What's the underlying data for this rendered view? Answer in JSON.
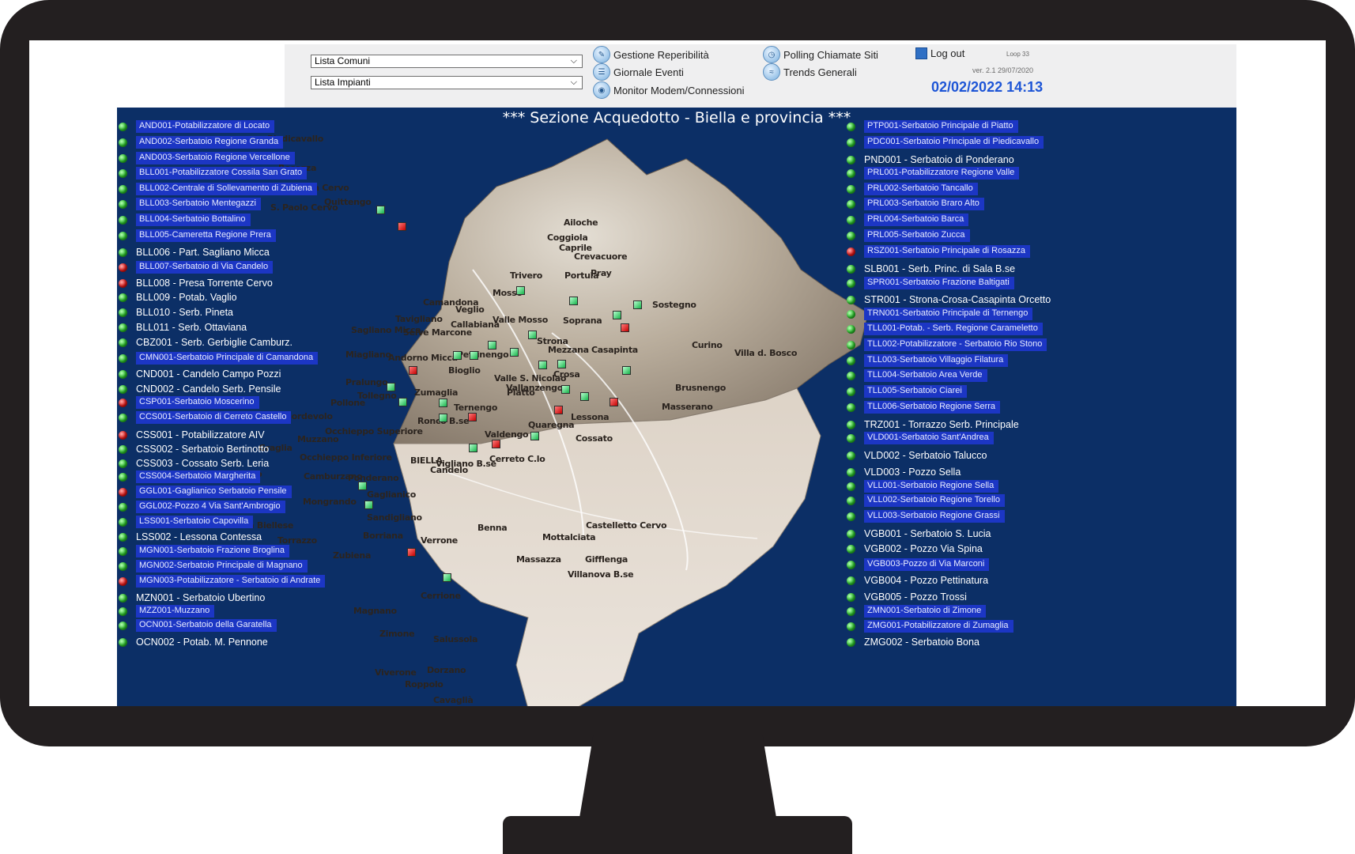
{
  "toolbar": {
    "lista_comuni": "Lista Comuni",
    "lista_impianti": "Lista Impianti",
    "links": {
      "gestione": "Gestione Reperibilità",
      "giornale": "Giornale Eventi",
      "monitor": "Monitor Modem/Connessioni",
      "polling": "Polling Chiamate Siti",
      "trends": "Trends Generali",
      "logout": "Log out"
    },
    "loop": "Loop   33",
    "version": "ver. 2.1 29/07/2020",
    "datetime": "02/02/2022 14:13"
  },
  "section_title": "*** Sezione Acquedotto - Biella e provincia ***",
  "left_sites": [
    {
      "label": "AND001-Potabilizzatore di Locato",
      "status": "green",
      "style": "box"
    },
    {
      "label": "AND002-Serbatoio Regione Granda",
      "status": "green",
      "style": "box"
    },
    {
      "label": "AND003-Serbatoio Regione Vercellone",
      "status": "green",
      "style": "box"
    },
    {
      "label": "BLL001-Potabilizzatore Cossila San Grato",
      "status": "green",
      "style": "box"
    },
    {
      "label": "BLL002-Centrale di Sollevamento di Zubiena",
      "status": "green",
      "style": "box"
    },
    {
      "label": "BLL003-Serbatoio Mentegazzi",
      "status": "green",
      "style": "box"
    },
    {
      "label": "BLL004-Serbatoio Bottalino",
      "status": "green",
      "style": "box"
    },
    {
      "label": "BLL005-Cameretta Regione Prera",
      "status": "green",
      "style": "box"
    },
    {
      "label": "BLL006 - Part. Sagliano Micca",
      "status": "green",
      "style": "big"
    },
    {
      "label": "BLL007-Serbatoio di Via Candelo",
      "status": "red",
      "style": "box"
    },
    {
      "label": "BLL008 - Presa Torrente Cervo",
      "status": "red",
      "style": "big"
    },
    {
      "label": "BLL009 - Potab. Vaglio",
      "status": "green",
      "style": "big"
    },
    {
      "label": "BLL010 - Serb. Pineta",
      "status": "green",
      "style": "big"
    },
    {
      "label": "BLL011 - Serb. Ottaviana",
      "status": "green",
      "style": "big"
    },
    {
      "label": "CBZ001 - Serb. Gerbiglie Camburz.",
      "status": "green",
      "style": "big"
    },
    {
      "label": "CMN001-Serbatoio Principale di Camandona",
      "status": "green",
      "style": "box"
    },
    {
      "label": "CND001 - Candelo Campo Pozzi",
      "status": "green",
      "style": "big"
    },
    {
      "label": "CND002 - Candelo Serb. Pensile",
      "status": "green",
      "style": "big"
    },
    {
      "label": "CSP001-Serbatoio Moscerino",
      "status": "red",
      "style": "box"
    },
    {
      "label": "CCS001-Serbatoio di Cerreto Castello",
      "status": "green",
      "style": "box"
    },
    {
      "label": "CSS001 - Potabilizzatore AIV",
      "status": "red",
      "style": "big"
    },
    {
      "label": "CSS002 - Serbatoio Bertinotto",
      "status": "green",
      "style": "big"
    },
    {
      "label": "CSS003 - Cossato Serb. Leria",
      "status": "green",
      "style": "big"
    },
    {
      "label": "CSS004-Serbatoio Margherita",
      "status": "green",
      "style": "box"
    },
    {
      "label": "GGL001-Gaglianico Serbatoio Pensile",
      "status": "red",
      "style": "box"
    },
    {
      "label": "GGL002-Pozzo 4 Via Sant'Ambrogio",
      "status": "green",
      "style": "box"
    },
    {
      "label": "LSS001-Serbatoio Capovilla",
      "status": "green",
      "style": "box"
    },
    {
      "label": "LSS002 - Lessona Contessa",
      "status": "green",
      "style": "big"
    },
    {
      "label": "MGN001-Serbatoio Frazione Broglina",
      "status": "green",
      "style": "box"
    },
    {
      "label": "MGN002-Serbatoio Principale di Magnano",
      "status": "green",
      "style": "box"
    },
    {
      "label": "MGN003-Potabilizzatore - Serbatoio di Andrate",
      "status": "red",
      "style": "box"
    },
    {
      "label": "MZN001 - Serbatoio Ubertino",
      "status": "green",
      "style": "big"
    },
    {
      "label": "MZZ001-Muzzano",
      "status": "green",
      "style": "box"
    },
    {
      "label": "OCN001-Serbatoio della Garatella",
      "status": "green",
      "style": "box"
    },
    {
      "label": "OCN002 - Potab. M. Pennone",
      "status": "green",
      "style": "big"
    }
  ],
  "right_sites": [
    {
      "label": "PTP001-Serbatoio Principale di Piatto",
      "status": "green",
      "style": "box"
    },
    {
      "label": "PDC001-Serbatoio Principale di Piedicavallo",
      "status": "green",
      "style": "box"
    },
    {
      "label": "PND001 - Serbatoio di Ponderano",
      "status": "green",
      "style": "big"
    },
    {
      "label": "PRL001-Potabilizzatore Regione Valle",
      "status": "green",
      "style": "box"
    },
    {
      "label": "PRL002-Serbatoio Tancallo",
      "status": "green",
      "style": "box"
    },
    {
      "label": "PRL003-Serbatoio Braro Alto",
      "status": "green",
      "style": "box"
    },
    {
      "label": "PRL004-Serbatoio Barca",
      "status": "green",
      "style": "box"
    },
    {
      "label": "PRL005-Serbatoio Zucca",
      "status": "green",
      "style": "box"
    },
    {
      "label": "RSZ001-Serbatoio Principale di Rosazza",
      "status": "red",
      "style": "box"
    },
    {
      "label": "SLB001 - Serb. Princ. di Sala B.se",
      "status": "green",
      "style": "big"
    },
    {
      "label": "SPR001-Serbatoio Frazione Baltigati",
      "status": "green",
      "style": "box"
    },
    {
      "label": "STR001 - Strona-Crosa-Casapinta Orcetto",
      "status": "green",
      "style": "big"
    },
    {
      "label": "TRN001-Serbatoio Principale di Ternengo",
      "status": "green",
      "style": "box"
    },
    {
      "label": "TLL001-Potab. - Serb. Regione Carameletto",
      "status": "green",
      "style": "box"
    },
    {
      "label": "TLL002-Potabilizzatore - Serbatoio Rio Stono",
      "status": "green",
      "style": "box"
    },
    {
      "label": "TLL003-Serbatoio Villaggio Filatura",
      "status": "green",
      "style": "box"
    },
    {
      "label": "TLL004-Serbatoio Area Verde",
      "status": "green",
      "style": "box"
    },
    {
      "label": "TLL005-Serbatoio Ciarei",
      "status": "green",
      "style": "box"
    },
    {
      "label": "TLL006-Serbatoio Regione Serra",
      "status": "green",
      "style": "box"
    },
    {
      "label": "TRZ001 - Torrazzo Serb. Principale",
      "status": "green",
      "style": "big"
    },
    {
      "label": "VLD001-Serbatoio Sant'Andrea",
      "status": "green",
      "style": "box"
    },
    {
      "label": "VLD002 - Serbatoio Talucco",
      "status": "green",
      "style": "big"
    },
    {
      "label": "VLD003 - Pozzo Sella",
      "status": "green",
      "style": "big"
    },
    {
      "label": "VLL001-Serbatoio Regione Sella",
      "status": "green",
      "style": "box"
    },
    {
      "label": "VLL002-Serbatoio Regione Torello",
      "status": "green",
      "style": "box"
    },
    {
      "label": "VLL003-Serbatoio Regione Grassi",
      "status": "green",
      "style": "box"
    },
    {
      "label": "VGB001 - Serbatoio S. Lucia",
      "status": "green",
      "style": "big"
    },
    {
      "label": "VGB002 - Pozzo Via Spina",
      "status": "green",
      "style": "big"
    },
    {
      "label": "VGB003-Pozzo di Via Marconi",
      "status": "green",
      "style": "box"
    },
    {
      "label": "VGB004 - Pozzo Pettinatura",
      "status": "green",
      "style": "big"
    },
    {
      "label": "VGB005 - Pozzo Trossi",
      "status": "green",
      "style": "big"
    },
    {
      "label": "ZMN001-Serbatoio di Zimone",
      "status": "green",
      "style": "box"
    },
    {
      "label": "ZMG001-Potabilizzatore di Zumaglia",
      "status": "green",
      "style": "box"
    },
    {
      "label": "ZMG002 - Serbatoio Bona",
      "status": "green",
      "style": "big"
    }
  ],
  "map_towns": [
    "Piedicavallo",
    "Rosazza",
    "Campiglia Cervo",
    "S. Paolo Cervo",
    "Quittengo",
    "Ailoche",
    "Coggiola",
    "Caprile",
    "Crevacuore",
    "Trivero",
    "Portula",
    "Pray",
    "Sostegno",
    "Camandona",
    "Veglio",
    "Mosso",
    "Valle Mosso",
    "Callabiana",
    "Tavigliano",
    "Sagliano Micca",
    "Selve Marcone",
    "Miagliano",
    "Andorno Micca",
    "Pettinengo",
    "Soprana",
    "Strona",
    "Mezzana",
    "Casapinta",
    "Curino",
    "Villa d. Bosco",
    "Pralungo",
    "Bioglio",
    "Valle S. Nicolao",
    "Crosa",
    "Tollegno",
    "Zumaglia",
    "Piatto",
    "Vallanzengo",
    "Brusnengo",
    "Pollone",
    "Ternengo",
    "Lessona",
    "Masserano",
    "Sordevolo",
    "Occhieppo Superiore",
    "Ronco B.se",
    "Quaregna",
    "Muzzano",
    "Valdengo",
    "Cossato",
    "Graglia",
    "Occhieppo Inferiore",
    "BIELLA",
    "Vigliano B.se",
    "Cerreto C.lo",
    "Donato",
    "Netro",
    "Camburzano",
    "Ponderano",
    "Candelo",
    "Gaglianico",
    "Mongrando",
    "Sandigliano",
    "Sala Biellese",
    "Borriana",
    "Benna",
    "Verrone",
    "Mottalciata",
    "Castelletto Cervo",
    "Torrazzo",
    "Zubiena",
    "Massazza",
    "Gifflenga",
    "Villanova B.se",
    "Magnano",
    "Cerrione",
    "Zimone",
    "Salussola",
    "Viverone",
    "Dorzano",
    "Roppolo",
    "Cavaglià"
  ],
  "map_markers_summary": {
    "green": 28,
    "red": 9
  }
}
